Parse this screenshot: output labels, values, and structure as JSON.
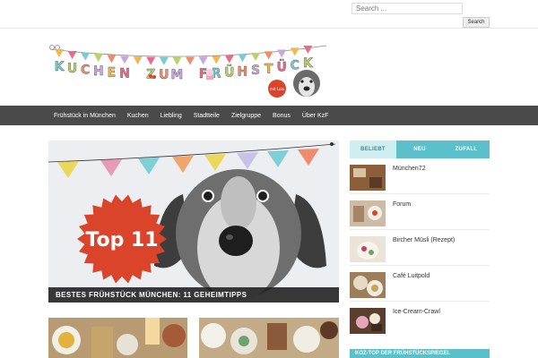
{
  "search": {
    "placeholder": "Search ...",
    "button_label": "Search"
  },
  "logo": {
    "letters": [
      "K",
      "U",
      "C",
      "H",
      "E",
      "N",
      " ",
      "Z",
      "U",
      "M",
      " ",
      "F",
      "R",
      "Ü",
      "H",
      "S",
      "T",
      "Ü",
      "C",
      "K"
    ],
    "badge": "mit Lola"
  },
  "nav": {
    "items": [
      {
        "label": "Frühstück in München"
      },
      {
        "label": "Kuchen"
      },
      {
        "label": "Liebling"
      },
      {
        "label": "Stadtteile"
      },
      {
        "label": "Zielgruppe"
      },
      {
        "label": "Bonus"
      },
      {
        "label": "Über KzF"
      }
    ]
  },
  "hero": {
    "badge": "Top 11",
    "caption": "BESTES FRÜHSTÜCK MÜNCHEN: 11 GEHEIMTIPPS"
  },
  "tabs": [
    {
      "label": "BELIEBT"
    },
    {
      "label": "NEU"
    },
    {
      "label": "ZUFALL"
    }
  ],
  "posts": [
    {
      "title": "München72"
    },
    {
      "title": "Forum"
    },
    {
      "title": "Bircher Müsli (Rezept)"
    },
    {
      "title": "Café Luitpold"
    },
    {
      "title": "Ice-Cream-Crawl"
    }
  ],
  "widget": {
    "title": "KOZ-TOP DER FRÜHSTÜCKSPIEGEL"
  },
  "colors": {
    "nav": "#4a4a4a",
    "accent": "#5bc0c9",
    "badge": "#d9442a"
  }
}
